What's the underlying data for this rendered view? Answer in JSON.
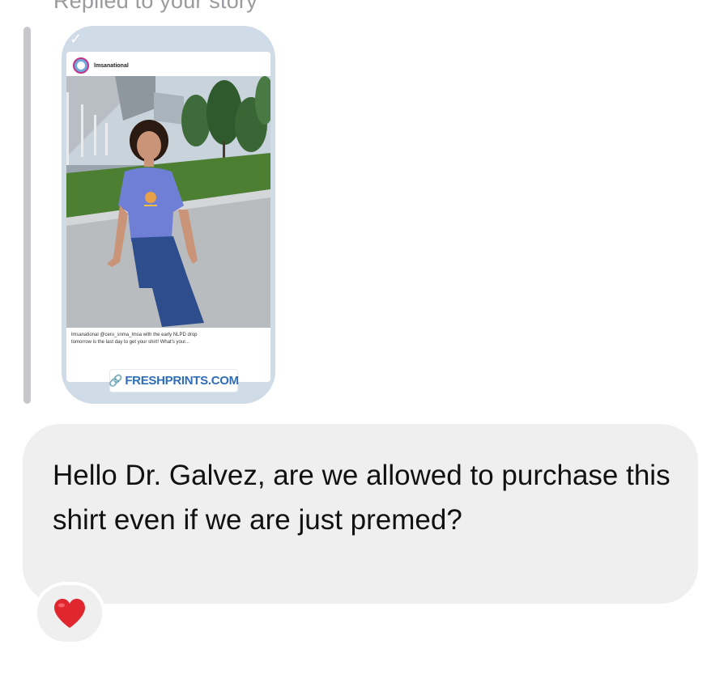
{
  "reply_header": "Replied to your story",
  "story": {
    "username": "lmsanational",
    "caption_line1": "lmsanational @ceru_snma_lmsa with the early NLPD drop",
    "caption_line2": "tomorrow is the last day to get your shirt! What's your...",
    "link_label": "FRESHPRINTS.COM"
  },
  "message": {
    "text": "Hello Dr. Galvez, are we allowed to purchase this shirt even if we are just premed?"
  },
  "reaction": {
    "icon": "heart-icon",
    "color": "#e0262f"
  }
}
